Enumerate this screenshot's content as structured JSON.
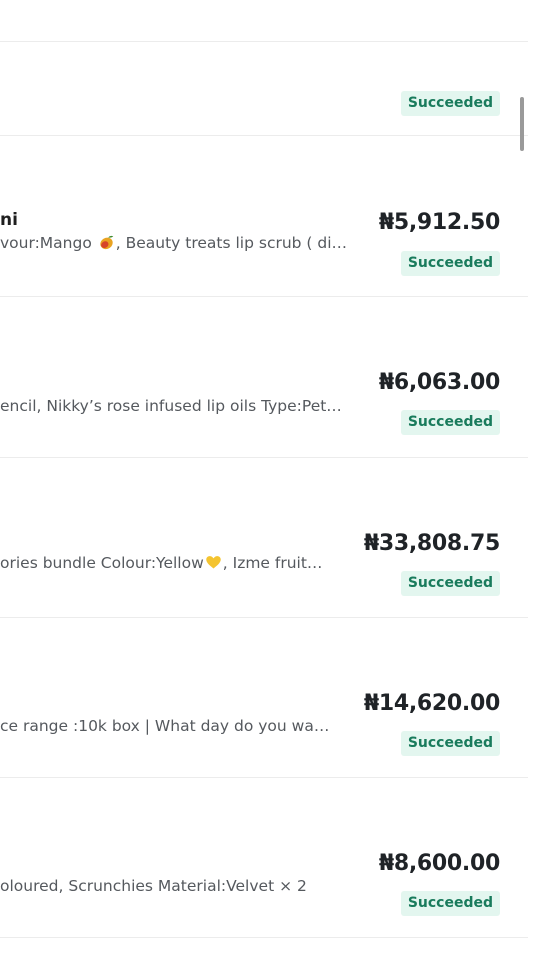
{
  "orders": [
    {
      "customer": "",
      "items_text": "",
      "amount": "",
      "status": "Succeeded"
    },
    {
      "customer": "ni",
      "items_prefix": "vour:Mango ",
      "emoji_icon": "mango-icon",
      "items_suffix": ", Beauty treats lip scrub ( di…",
      "amount": "₦5,912.50",
      "status": "Succeeded"
    },
    {
      "items_text": "encil, Nikky’s rose infused lip oils Type:Pet…",
      "amount": "₦6,063.00",
      "status": "Succeeded"
    },
    {
      "items_prefix": "ories bundle Colour:Yellow",
      "emoji_icon": "yellow-heart-icon",
      "items_suffix": ", Izme fruit…",
      "amount": "₦33,808.75",
      "status": "Succeeded"
    },
    {
      "items_text": "ce range :10k box | What day do you wa…",
      "amount": "₦14,620.00",
      "status": "Succeeded"
    },
    {
      "items_text": "oloured, Scrunchies Material:Velvet × 2",
      "amount": "₦8,600.00",
      "status": "Succeeded"
    }
  ],
  "colors": {
    "badge_bg": "#e3f6ef",
    "badge_text": "#197b5c",
    "divider": "#ececec",
    "amount_text": "#1f2327",
    "items_text": "#55595e"
  },
  "scrollbar": {
    "visible": true
  }
}
